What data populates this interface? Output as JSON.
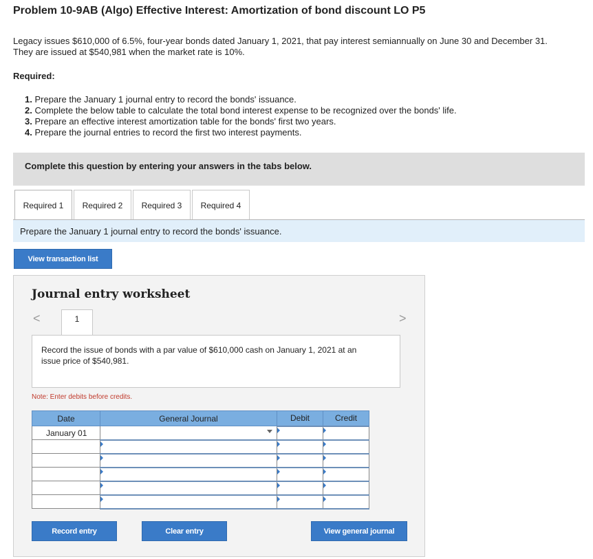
{
  "problem": {
    "title": "Problem 10-9AB (Algo) Effective Interest: Amortization of bond discount LO P5",
    "intro_line1": "Legacy issues $610,000 of 6.5%, four-year bonds dated January 1, 2021, that pay interest semiannually on June 30 and December 31.",
    "intro_line2": "They are issued at $540,981 when the market rate is 10%.",
    "required_heading": "Required:",
    "requirements": [
      {
        "num": "1.",
        "text": "Prepare the January 1 journal entry to record the bonds' issuance."
      },
      {
        "num": "2.",
        "text": "Complete the below table to calculate the total bond interest expense to be recognized over the bonds' life."
      },
      {
        "num": "3.",
        "text": "Prepare an effective interest amortization table for the bonds' first two years."
      },
      {
        "num": "4.",
        "text": "Prepare the journal entries to record the first two interest payments."
      }
    ]
  },
  "instructions": {
    "complete_text": "Complete this question by entering your answers in the tabs below."
  },
  "tabs": [
    {
      "label": "Required 1",
      "active": true
    },
    {
      "label": "Required 2",
      "active": false
    },
    {
      "label": "Required 3",
      "active": false
    },
    {
      "label": "Required 4",
      "active": false
    }
  ],
  "active_tab_prompt": "Prepare the January 1 journal entry to record the bonds' issuance.",
  "buttons": {
    "view_transaction_list": "View transaction list",
    "record_entry": "Record entry",
    "clear_entry": "Clear entry",
    "view_general_journal": "View general journal"
  },
  "worksheet": {
    "title": "Journal entry worksheet",
    "page_number": "1",
    "prev_arrow": "<",
    "next_arrow": ">",
    "description": "Record the issue of bonds with a par value of $610,000 cash on January 1, 2021 at an issue price of $540,981.",
    "note": "Note: Enter debits before credits."
  },
  "journal_table": {
    "headers": {
      "date": "Date",
      "general_journal": "General Journal",
      "debit": "Debit",
      "credit": "Credit"
    },
    "rows": [
      {
        "date": "January 01",
        "account": "",
        "debit": "",
        "credit": ""
      },
      {
        "date": "",
        "account": "",
        "debit": "",
        "credit": ""
      },
      {
        "date": "",
        "account": "",
        "debit": "",
        "credit": ""
      },
      {
        "date": "",
        "account": "",
        "debit": "",
        "credit": ""
      },
      {
        "date": "",
        "account": "",
        "debit": "",
        "credit": ""
      },
      {
        "date": "",
        "account": "",
        "debit": "",
        "credit": ""
      }
    ]
  },
  "colors": {
    "accent_blue": "#3a7bc8",
    "table_header": "#7aaee0",
    "prompt_band": "#e1effa",
    "note_red": "#c0392b"
  }
}
